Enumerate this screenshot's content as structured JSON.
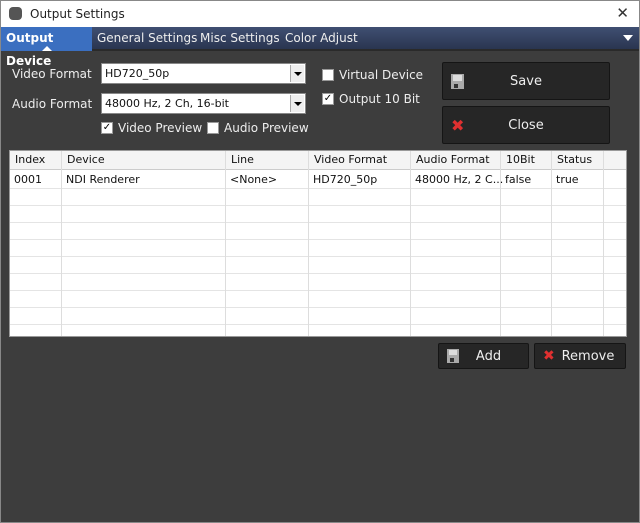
{
  "window": {
    "title": "Output Settings",
    "close": "✕"
  },
  "tabs": [
    "Output Device",
    "General Settings",
    "Misc Settings",
    "Color Adjust"
  ],
  "form": {
    "video_format_label": "Video Format",
    "video_format": "HD720_50p",
    "audio_format_label": "Audio Format",
    "audio_format": "48000 Hz, 2 Ch, 16-bit",
    "video_preview": {
      "label": "Video Preview",
      "checked": true
    },
    "audio_preview": {
      "label": "Audio Preview",
      "checked": false
    },
    "virtual_device": {
      "label": "Virtual Device",
      "checked": false
    },
    "output_10bit": {
      "label": "Output 10 Bit",
      "checked": true
    }
  },
  "buttons": {
    "save": "Save",
    "close": "Close",
    "add": "Add",
    "remove": "Remove"
  },
  "table": {
    "columns": [
      "Index",
      "Device",
      "Line",
      "Video Format",
      "Audio Format",
      "10Bit",
      "Status"
    ],
    "rows": [
      [
        "0001",
        "NDI Renderer",
        "<None>",
        "HD720_50p",
        "48000 Hz, 2 C...",
        "false",
        "true"
      ]
    ]
  },
  "colors": {
    "accent": "#3b6fc0",
    "close_icon": "#e03030"
  }
}
